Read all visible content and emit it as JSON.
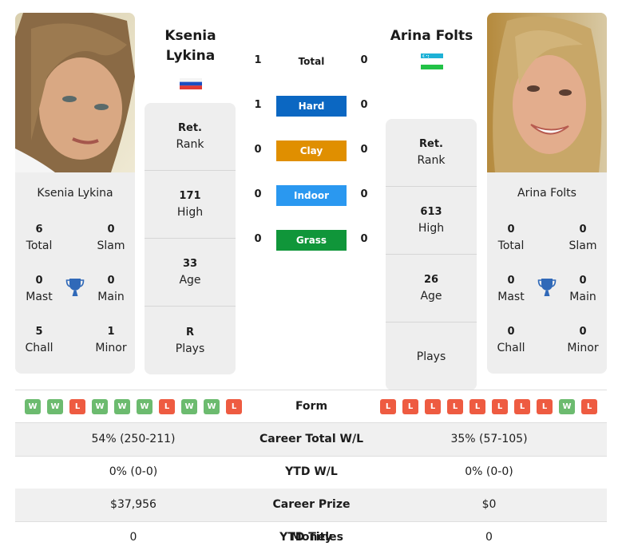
{
  "colors": {
    "win": "#6cbb6f",
    "loss": "#ee5b41",
    "hard": "#0b67c2",
    "clay": "#e08f00",
    "indoor": "#2a98f0",
    "grass": "#10963a",
    "trophy": "#3069b8"
  },
  "player1": {
    "name_line1": "Ksenia",
    "name_line2": "Lykina",
    "full_name": "Ksenia Lykina",
    "flag": "russia-flag",
    "photo": "player-photo",
    "titles": [
      {
        "value": "6",
        "label": "Total"
      },
      {
        "value": "0",
        "label": "Slam"
      },
      {
        "value": "0",
        "label": "Mast"
      },
      {
        "value": "0",
        "label": "Main"
      },
      {
        "value": "5",
        "label": "Chall"
      },
      {
        "value": "1",
        "label": "Minor"
      }
    ],
    "info": [
      {
        "value": "Ret.",
        "label": "Rank"
      },
      {
        "value": "171",
        "label": "High"
      },
      {
        "value": "33",
        "label": "Age"
      },
      {
        "value": "R",
        "label": "Plays"
      }
    ],
    "form": [
      "W",
      "W",
      "L",
      "W",
      "W",
      "W",
      "L",
      "W",
      "W",
      "L"
    ]
  },
  "player2": {
    "name": "Arina Folts",
    "full_name": "Arina Folts",
    "flag": "uzbekistan-flag",
    "photo": "player-photo",
    "titles": [
      {
        "value": "0",
        "label": "Total"
      },
      {
        "value": "0",
        "label": "Slam"
      },
      {
        "value": "0",
        "label": "Mast"
      },
      {
        "value": "0",
        "label": "Main"
      },
      {
        "value": "0",
        "label": "Chall"
      },
      {
        "value": "0",
        "label": "Minor"
      }
    ],
    "info": [
      {
        "value": "Ret.",
        "label": "Rank"
      },
      {
        "value": "613",
        "label": "High"
      },
      {
        "value": "26",
        "label": "Age"
      },
      {
        "value": "",
        "label": "Plays"
      }
    ],
    "form": [
      "L",
      "L",
      "L",
      "L",
      "L",
      "L",
      "L",
      "L",
      "W",
      "L"
    ]
  },
  "h2h": [
    {
      "label": "Total",
      "p1": "1",
      "p2": "0",
      "style": "plain"
    },
    {
      "label": "Hard",
      "p1": "1",
      "p2": "0",
      "style": "hard"
    },
    {
      "label": "Clay",
      "p1": "0",
      "p2": "0",
      "style": "clay"
    },
    {
      "label": "Indoor",
      "p1": "0",
      "p2": "0",
      "style": "indoor"
    },
    {
      "label": "Grass",
      "p1": "0",
      "p2": "0",
      "style": "grass"
    }
  ],
  "form_label": "Form",
  "stats": [
    {
      "label": "Career Total W/L",
      "p1": "54% (250-211)",
      "p2": "35% (57-105)"
    },
    {
      "label": "YTD W/L",
      "p1": "0% (0-0)",
      "p2": "0% (0-0)"
    },
    {
      "label": "Career Prize Money",
      "p1": "$37,956",
      "p2": "$0"
    },
    {
      "label": "YTD Titles",
      "p1": "0",
      "p2": "0"
    }
  ]
}
